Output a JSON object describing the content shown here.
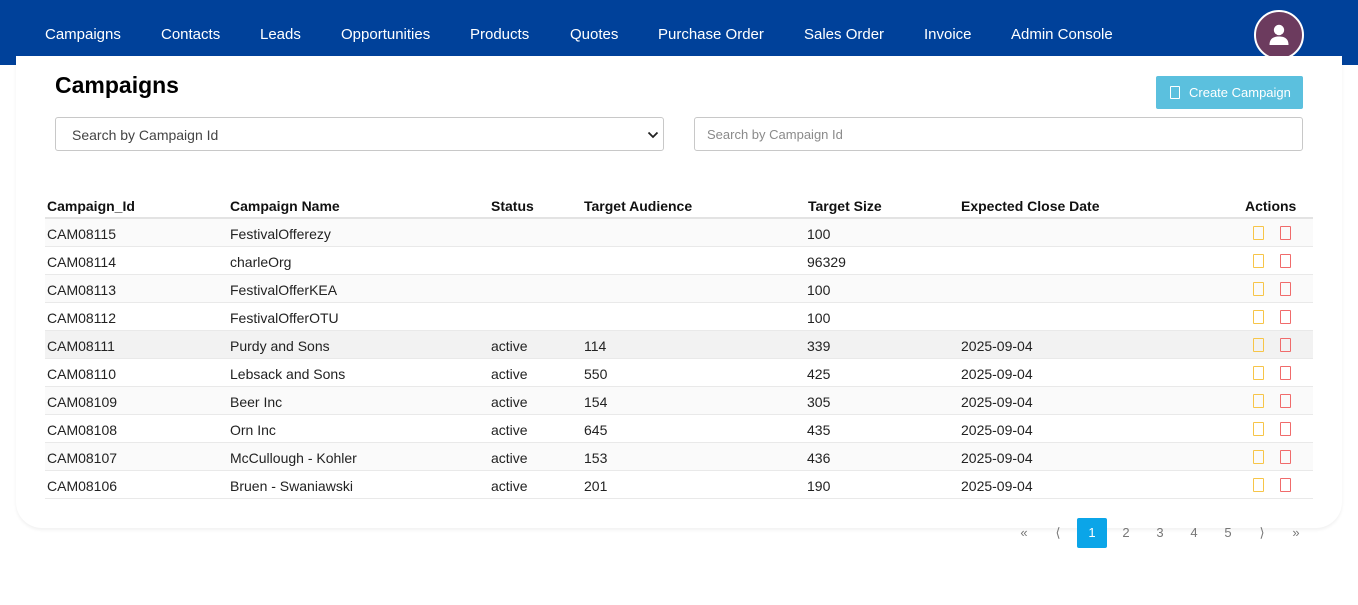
{
  "nav": {
    "items": [
      "Campaigns",
      "Contacts",
      "Leads",
      "Opportunities",
      "Products",
      "Quotes",
      "Purchase Order",
      "Sales Order",
      "Invoice",
      "Admin Console"
    ],
    "avatar_icon": "user-icon"
  },
  "page": {
    "title": "Campaigns",
    "create_label": "Create Campaign"
  },
  "filters": {
    "select_value": "Search by Campaign Id",
    "search_placeholder": "Search by Campaign Id"
  },
  "table": {
    "headers": [
      "Campaign_Id",
      "Campaign Name",
      "Status",
      "Target Audience",
      "Target Size",
      "Expected Close Date",
      "Actions"
    ],
    "rows": [
      [
        "CAM08115",
        "FestivalOfferezy",
        "",
        "",
        "100",
        ""
      ],
      [
        "CAM08114",
        "charleOrg",
        "",
        "",
        "96329",
        ""
      ],
      [
        "CAM08113",
        "FestivalOfferKEA",
        "",
        "",
        "100",
        ""
      ],
      [
        "CAM08112",
        "FestivalOfferOTU",
        "",
        "",
        "100",
        ""
      ],
      [
        "CAM08111",
        "Purdy and Sons",
        "active",
        "114",
        "339",
        "2025-09-04"
      ],
      [
        "CAM08110",
        "Lebsack and Sons",
        "active",
        "550",
        "425",
        "2025-09-04"
      ],
      [
        "CAM08109",
        "Beer Inc",
        "active",
        "154",
        "305",
        "2025-09-04"
      ],
      [
        "CAM08108",
        "Orn Inc",
        "active",
        "645",
        "435",
        "2025-09-04"
      ],
      [
        "CAM08107",
        "McCullough - Kohler",
        "active",
        "153",
        "436",
        "2025-09-04"
      ],
      [
        "CAM08106",
        "Bruen - Swaniawski",
        "active",
        "201",
        "190",
        "2025-09-04"
      ]
    ],
    "action_icons": [
      "edit-icon",
      "delete-icon"
    ]
  },
  "pagination": {
    "first": "«",
    "prev": "⟨",
    "pages": [
      "1",
      "2",
      "3",
      "4",
      "5"
    ],
    "next": "⟩",
    "last": "»",
    "current": "1"
  },
  "colors": {
    "navbar": "#00419a",
    "create_button": "#5bc0de",
    "active_page": "#0ba5e8",
    "edit_icon": "#f7c548",
    "delete_icon": "#f06b6b"
  }
}
